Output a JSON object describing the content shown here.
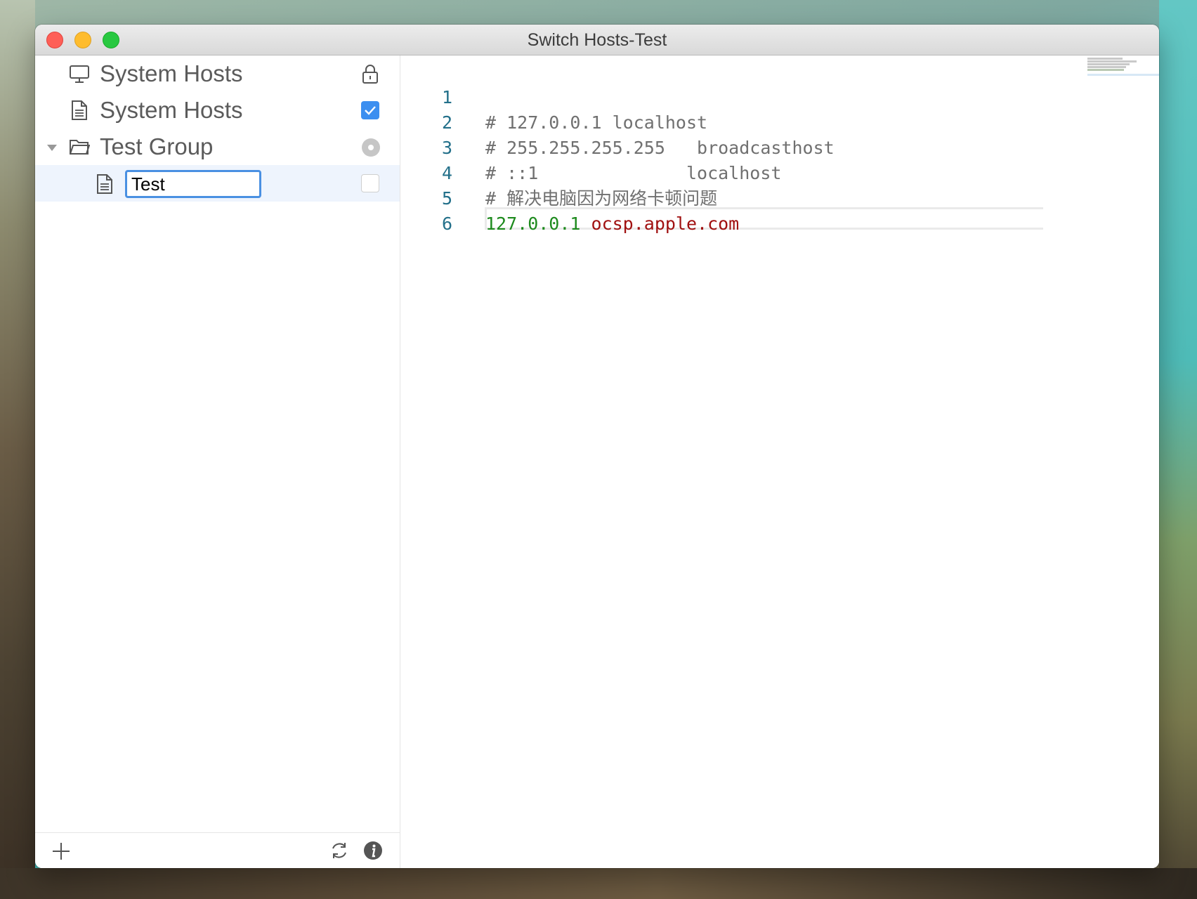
{
  "window": {
    "title": "Switch Hosts-Test"
  },
  "sidebar": {
    "items": [
      {
        "label": "System Hosts",
        "icon": "monitor-icon",
        "status": "lock-icon"
      },
      {
        "label": "System Hosts",
        "icon": "document-icon",
        "status": "checked"
      },
      {
        "label": "Test Group",
        "icon": "folder-icon",
        "status": "radio-dot",
        "expanded": true
      },
      {
        "label": "Test",
        "icon": "document-icon",
        "status": "unchecked",
        "editing": true
      }
    ],
    "footer": {
      "add": "plus-icon",
      "refresh": "refresh-icon",
      "info": "info-icon"
    }
  },
  "editor": {
    "lines": [
      {
        "num": "1",
        "comment": "# 127.0.0.1 localhost",
        "ip": "",
        "host": ""
      },
      {
        "num": "2",
        "comment": "# 255.255.255.255   broadcasthost",
        "ip": "",
        "host": ""
      },
      {
        "num": "3",
        "comment": "# ::1              localhost",
        "ip": "",
        "host": ""
      },
      {
        "num": "4",
        "comment": "# 解决电脑因为网络卡顿问题",
        "ip": "",
        "host": ""
      },
      {
        "num": "5",
        "comment": "",
        "ip": "127.0.0.1",
        "host": " ocsp.apple.com"
      },
      {
        "num": "6",
        "comment": "",
        "ip": "",
        "host": ""
      }
    ]
  },
  "colors": {
    "accent": "#4a90e2",
    "comment": "#707070",
    "ip": "#1d8a1d",
    "host": "#a01010",
    "line_number": "#23708a"
  }
}
